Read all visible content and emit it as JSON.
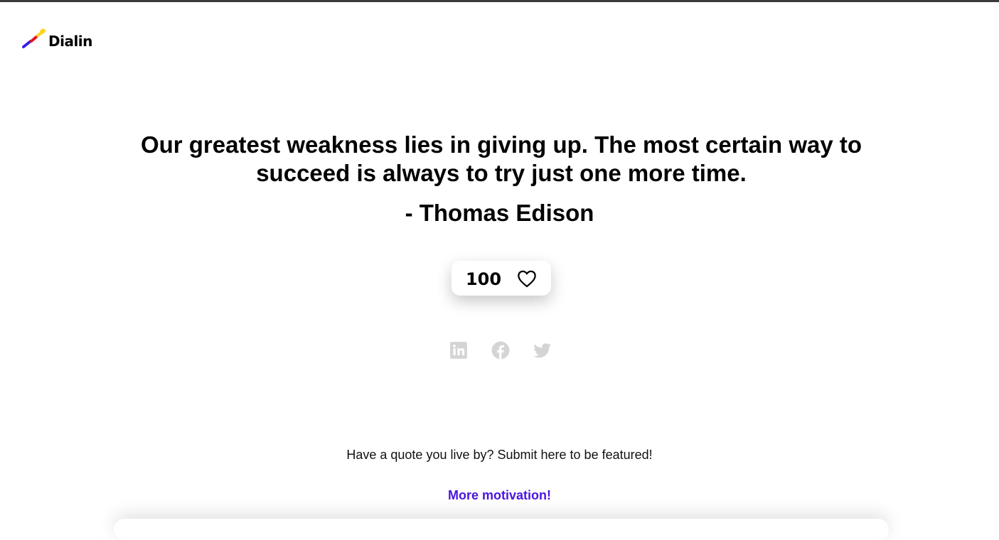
{
  "brand": {
    "name": "Dialin",
    "logo_icon": "dialin-logo-icon",
    "colors": [
      "#3b1de6",
      "#e8141e",
      "#ffd21f"
    ]
  },
  "quote": {
    "text": "Our greatest weakness lies in giving up. The most certain way to succeed is always to try just one more time.",
    "author": "- Thomas Edison"
  },
  "likes": {
    "count": "100",
    "icon": "heart-icon"
  },
  "social": [
    {
      "name": "linkedin",
      "icon": "linkedin-icon"
    },
    {
      "name": "facebook",
      "icon": "facebook-icon"
    },
    {
      "name": "twitter",
      "icon": "twitter-icon"
    }
  ],
  "footer": {
    "submit_text": "Have a quote you live by? Submit here to be featured!",
    "more_link": "More motivation!"
  },
  "colors": {
    "accent": "#4a16e0",
    "social_icon": "#d4d4d4"
  }
}
